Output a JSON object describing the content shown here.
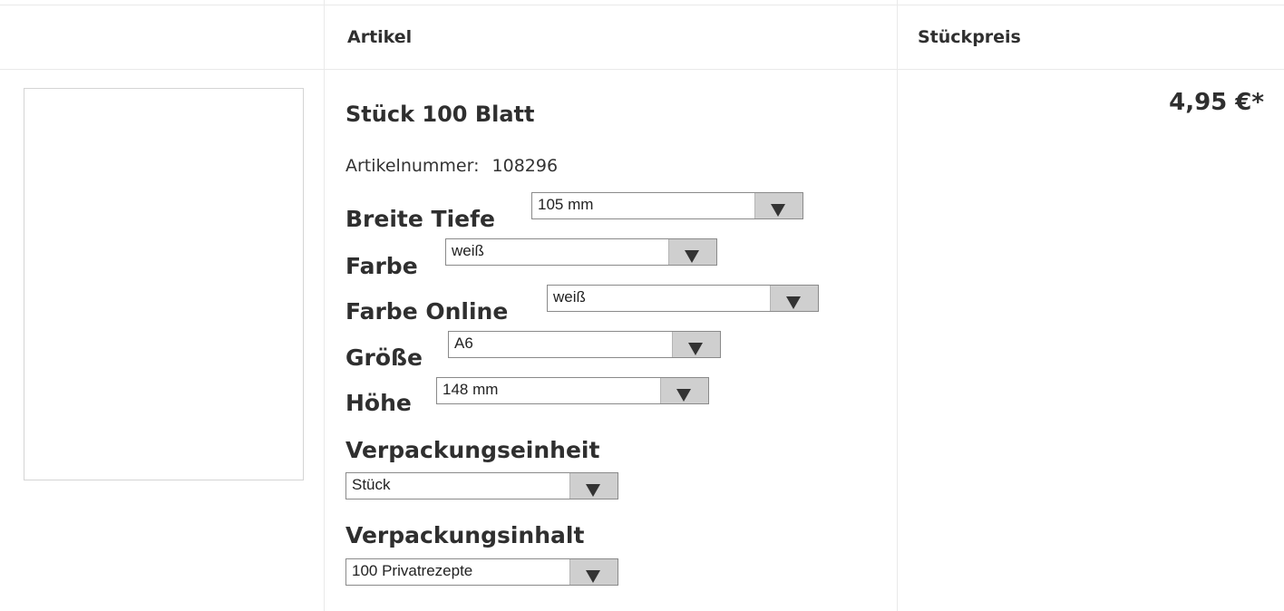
{
  "columns": {
    "article": "Artikel",
    "unit_price": "Stückpreis"
  },
  "product": {
    "title": "Stück 100 Blatt",
    "article_number_label": "Artikelnummer:",
    "article_number": "108296",
    "price": "4,95 €*"
  },
  "options": [
    {
      "label": "Breite Tiefe",
      "value": "105 mm"
    },
    {
      "label": "Farbe",
      "value": "weiß"
    },
    {
      "label": "Farbe Online",
      "value": "weiß"
    },
    {
      "label": "Größe",
      "value": "A6"
    },
    {
      "label": "Höhe",
      "value": "148 mm"
    },
    {
      "label": "Verpackungseinheit",
      "value": "Stück"
    },
    {
      "label": "Verpackungsinhalt",
      "value": "100 Privatrezepte"
    }
  ],
  "icons": {
    "dropdown": "triangle-down-icon"
  },
  "colors": {
    "text": "#2f2f2f",
    "select_button": "#cfcfcf",
    "border": "#e9e9e9"
  }
}
